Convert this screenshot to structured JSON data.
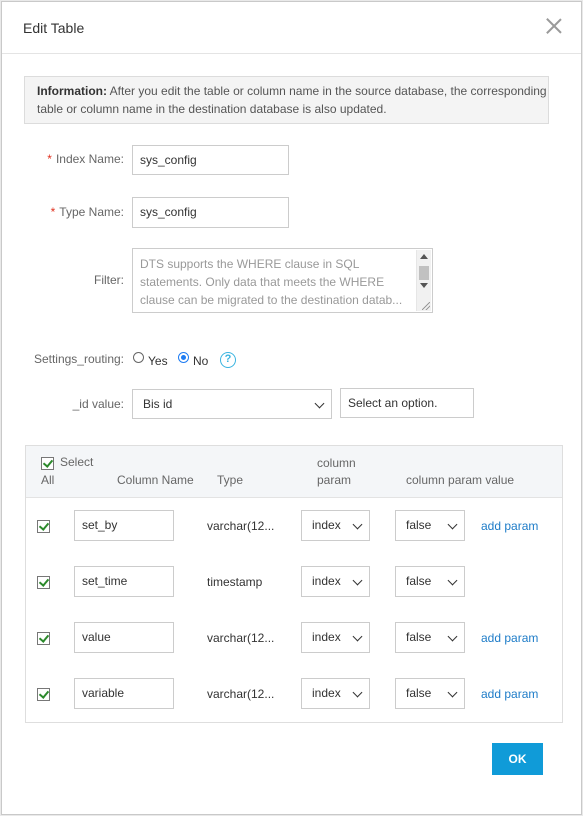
{
  "dialog": {
    "title": "Edit Table"
  },
  "info": {
    "label": "Information:",
    "text": " After you edit the table or column name in the source database, the corresponding table or column name in the destination database is also updated."
  },
  "form": {
    "index_name": {
      "label": "Index Name:",
      "required_mark": "*",
      "value": "sys_config"
    },
    "type_name": {
      "label": "Type Name:",
      "required_mark": "*",
      "value": "sys_config"
    },
    "filter": {
      "label": "Filter:",
      "placeholder": "DTS supports the WHERE clause in SQL statements. Only data that meets the WHERE clause can be migrated to the destination datab..."
    },
    "settings_routing": {
      "label": "Settings_routing:",
      "options": [
        "Yes",
        "No"
      ],
      "selected": "No",
      "help_glyph": "?"
    },
    "id_value": {
      "label": "_id value:",
      "selected": "Bis id",
      "second_placeholder": "Select an option."
    }
  },
  "table": {
    "headers": {
      "select_all_1": "Select",
      "select_all_2": "All",
      "column_name": "Column Name",
      "type": "Type",
      "column_param_1": "column",
      "column_param_2": "param",
      "column_param_value": "column param value"
    },
    "rows": [
      {
        "checked": true,
        "name": "set_by",
        "type": "varchar(12...",
        "param": "index",
        "param_value": "false",
        "action": "add param"
      },
      {
        "checked": true,
        "name": "set_time",
        "type": "timestamp",
        "param": "index",
        "param_value": "false",
        "action": ""
      },
      {
        "checked": true,
        "name": "value",
        "type": "varchar(12...",
        "param": "index",
        "param_value": "false",
        "action": "add param"
      },
      {
        "checked": true,
        "name": "variable",
        "type": "varchar(12...",
        "param": "index",
        "param_value": "false",
        "action": "add param"
      }
    ]
  },
  "footer": {
    "ok_label": "OK"
  }
}
